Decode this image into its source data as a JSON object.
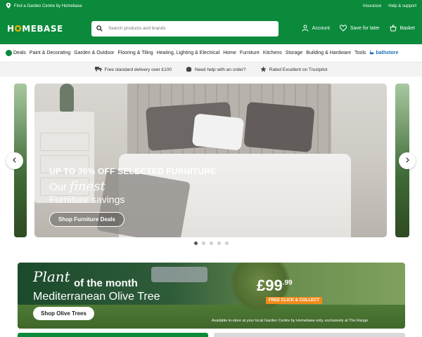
{
  "topbar": {
    "find_store": "Find a Garden Centre by Homebase",
    "links": [
      "Insurance",
      "Help & support"
    ]
  },
  "header": {
    "logo": "HOMEBASE",
    "search_placeholder": "Search products and brands",
    "actions": {
      "account": "Account",
      "save_for_later": "Save for later",
      "basket": "Basket"
    }
  },
  "nav": {
    "deals": "Deals",
    "items": [
      "Paint & Decorating",
      "Garden & Outdoor",
      "Flooring & Tiling",
      "Heating, Lighting & Electrical",
      "Home",
      "Furniture",
      "Kitchens",
      "Storage",
      "Building & Hardware",
      "Tools"
    ],
    "bathstore": "bathstore"
  },
  "usp": {
    "delivery": "Free standard delivery over £100",
    "help": "Need help with an order?",
    "trustpilot": "Rated Excellent on Trustpilot"
  },
  "hero": {
    "promo_prefix": "UP TO",
    "promo_pct": "35%",
    "promo_suffix": "OFF SELECTED FURNITURE",
    "line2_prefix": "Our",
    "line2_finest": "finest",
    "line3": "Furniture savings",
    "cta": "Shop Furniture Deals",
    "slide_count": 5,
    "active_slide": 1
  },
  "promo": {
    "plant_script": "Plant",
    "plant_bold": "of the month",
    "product": "Mediterranean Olive Tree",
    "cta": "Shop Olive Trees",
    "price_main": "£99",
    "price_pence": ".99",
    "badge": "FREE CLICK & COLLECT",
    "fine_print": "Available in-store at your local Garden Centre by Homebase only, exclusively at The Range"
  },
  "colors": {
    "brand": "#0b8a3b",
    "accent": "#f6b800",
    "promo_badge": "#f28a1a"
  }
}
